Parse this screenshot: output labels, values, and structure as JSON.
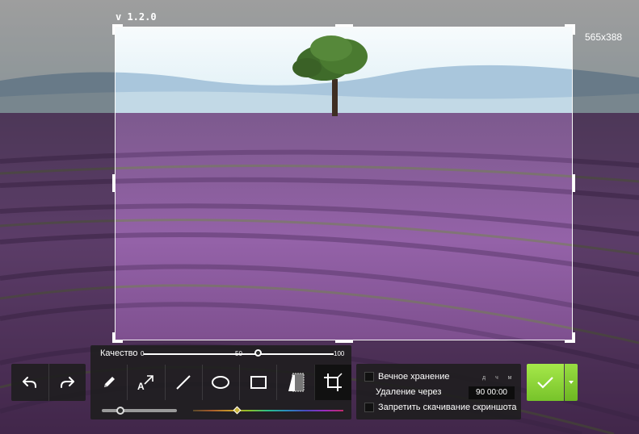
{
  "version_label": "v 1.2.0",
  "selection_size": "565x388",
  "history": {
    "undo_icon": "undo-icon",
    "redo_icon": "redo-icon"
  },
  "quality": {
    "label": "Качество",
    "min": "0",
    "mid": "50",
    "max": "100",
    "value": 63
  },
  "tools": [
    {
      "name": "pencil-tool",
      "icon": "pencil-icon"
    },
    {
      "name": "arrow-text-tool",
      "icon": "arrow-text-icon"
    },
    {
      "name": "line-tool",
      "icon": "line-icon"
    },
    {
      "name": "ellipse-tool",
      "icon": "ellipse-icon"
    },
    {
      "name": "rectangle-tool",
      "icon": "rectangle-icon"
    },
    {
      "name": "marker-tool",
      "icon": "marker-icon"
    },
    {
      "name": "crop-tool",
      "icon": "crop-icon",
      "active": true
    }
  ],
  "options": {
    "permanent_storage": "Вечное хранение",
    "delete_after": "Удаление через",
    "time_units": [
      "д",
      "ч",
      "м"
    ],
    "time_value": "90 00:00",
    "forbid_download": "Запретить скачивание скриншота"
  },
  "colors": {
    "accent_green": "#8fd93a",
    "panel_bg": "#1e1e1e",
    "lavender": "#8a5a9e"
  }
}
